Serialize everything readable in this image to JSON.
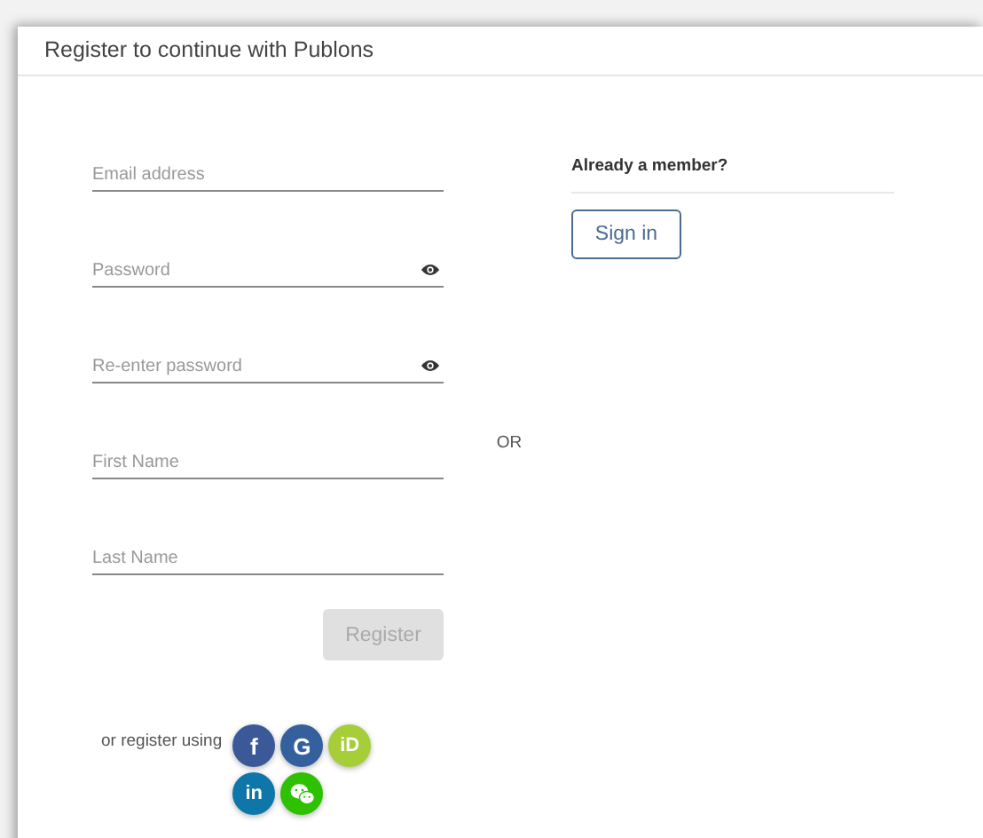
{
  "dialog": {
    "title": "Register to continue with Publons"
  },
  "form": {
    "fields": [
      {
        "placeholder": "Email address",
        "kind": "text"
      },
      {
        "placeholder": "Password",
        "kind": "password"
      },
      {
        "placeholder": "Re-enter password",
        "kind": "password"
      },
      {
        "placeholder": "First Name",
        "kind": "text"
      },
      {
        "placeholder": "Last Name",
        "kind": "text"
      }
    ],
    "register_button": {
      "label": "Register",
      "disabled": true
    },
    "social_label": "or register using",
    "social_buttons": [
      {
        "kind": "facebook",
        "label": "f",
        "color": "#3b5998"
      },
      {
        "kind": "google",
        "label": "G",
        "color": "#35609e"
      },
      {
        "kind": "orcid",
        "label": "iD",
        "color": "#a6ce39"
      },
      {
        "kind": "linkedin",
        "label": "in",
        "color": "#0e76a8"
      },
      {
        "kind": "wechat",
        "color": "#2dc100"
      }
    ]
  },
  "separator": "OR",
  "member": {
    "heading": "Already a member?",
    "button": "Sign in"
  }
}
